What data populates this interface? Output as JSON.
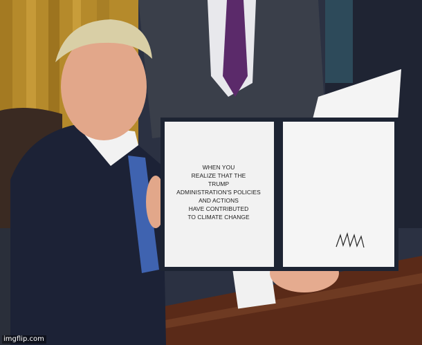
{
  "caption": {
    "lines": [
      "WHEN YOU",
      "REALIZE THAT THE",
      "TRUMP",
      "ADMINISTRATION'S POLICIES",
      "AND ACTIONS",
      "HAVE CONTRIBUTED",
      "TO CLIMATE CHANGE"
    ]
  },
  "watermark": {
    "text": "imgflip.com"
  },
  "colors": {
    "suit": "#1c2236",
    "curtain": "#b58a2b",
    "desk": "#5a2a18",
    "folder": "#1d2433",
    "paper": "#f2f2f2"
  }
}
